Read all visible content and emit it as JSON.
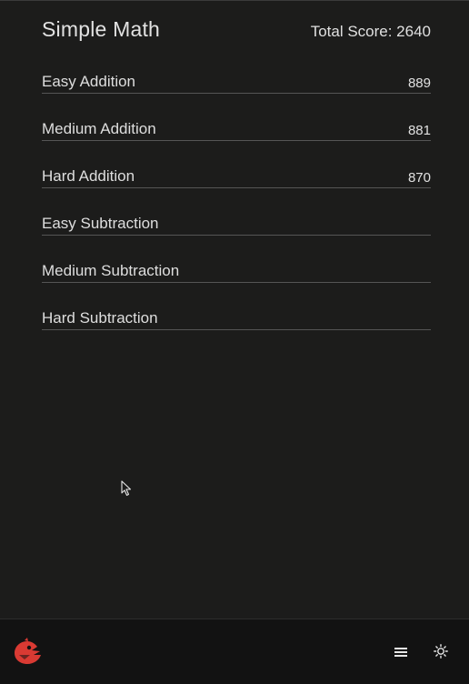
{
  "header": {
    "title": "Simple Math",
    "total_score": "Total Score: 2640"
  },
  "games": [
    {
      "label": "Easy Addition",
      "score": "889"
    },
    {
      "label": "Medium Addition",
      "score": "881"
    },
    {
      "label": "Hard Addition",
      "score": "870"
    },
    {
      "label": "Easy Subtraction",
      "score": ""
    },
    {
      "label": "Medium Subtraction",
      "score": ""
    },
    {
      "label": "Hard Subtraction",
      "score": ""
    }
  ],
  "bottombar": {
    "logo_icon": "red-bird-logo-icon",
    "menu_icon": "hamburger-menu-icon",
    "theme_icon": "sun-icon"
  },
  "colors": {
    "background": "#1c1c1b",
    "bottombar": "#121212",
    "text": "#dcdcdc",
    "divider": "#555555",
    "logo_red": "#d93a33"
  }
}
